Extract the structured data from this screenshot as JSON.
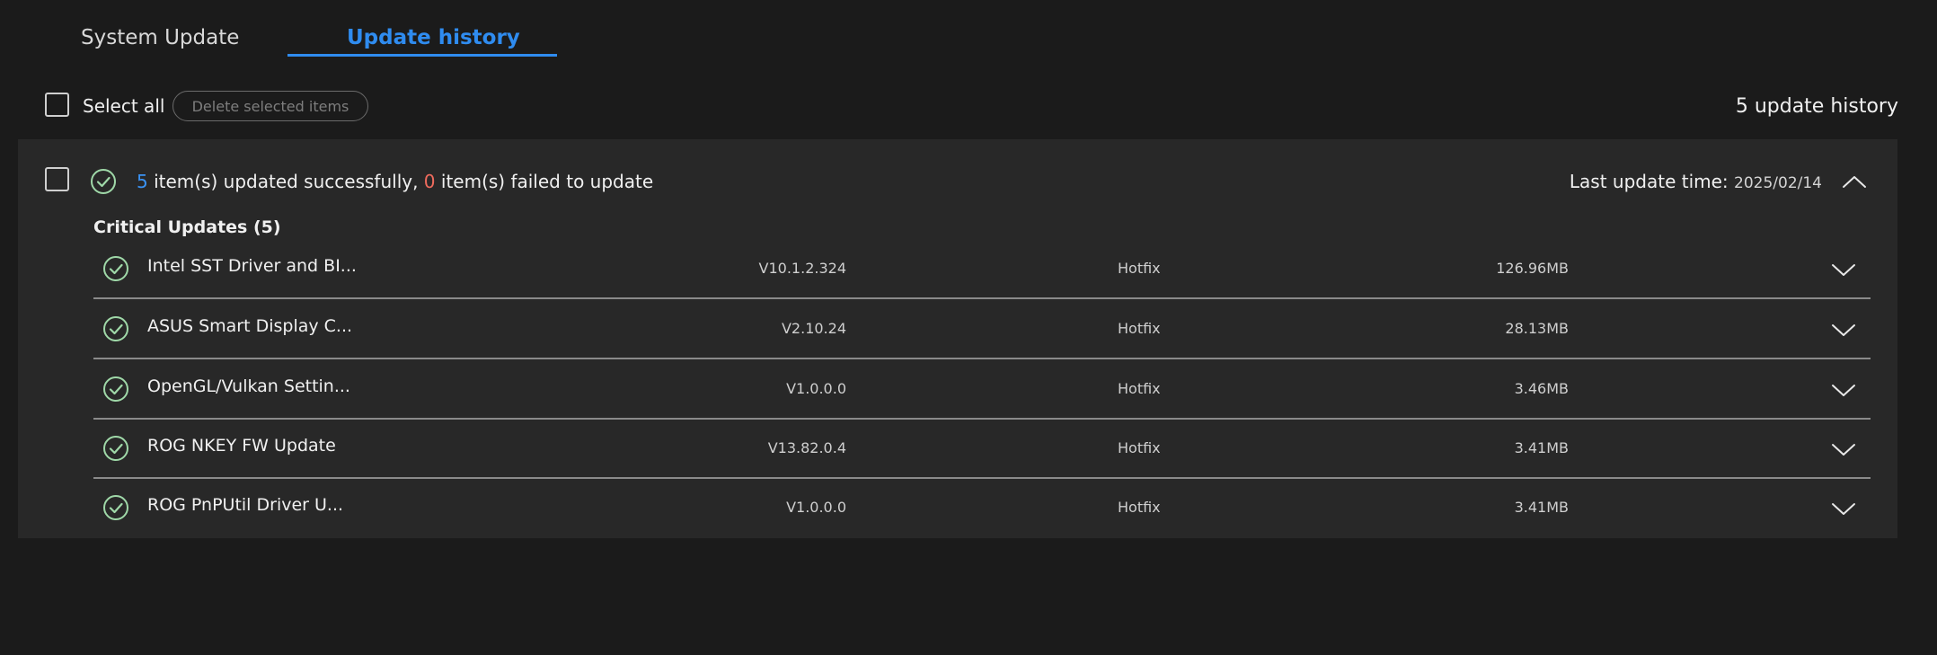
{
  "tabs": [
    {
      "label": "System Update",
      "active": false
    },
    {
      "label": "Update history",
      "active": true
    }
  ],
  "toolbar": {
    "select_all_label": "Select all",
    "delete_label": "Delete selected items",
    "history_count_label": "5 update history"
  },
  "summary": {
    "success_count": "5",
    "success_text": " item(s) updated successfully, ",
    "fail_count": "0",
    "fail_text": " item(s) failed to update",
    "last_update_label": "Last update time: ",
    "last_update_date": "2025/02/14"
  },
  "group": {
    "title": "Critical Updates (5)",
    "items": [
      {
        "name": "Intel SST Driver and BI...",
        "version": "V10.1.2.324",
        "type": "Hotfix",
        "size": "126.96MB"
      },
      {
        "name": "ASUS Smart Display C...",
        "version": "V2.10.24",
        "type": "Hotfix",
        "size": "28.13MB"
      },
      {
        "name": "OpenGL/Vulkan Settin...",
        "version": "V1.0.0.0",
        "type": "Hotfix",
        "size": "3.46MB"
      },
      {
        "name": "ROG NKEY FW Update",
        "version": "V13.82.0.4",
        "type": "Hotfix",
        "size": "3.41MB"
      },
      {
        "name": "ROG PnPUtil Driver U...",
        "version": "V1.0.0.0",
        "type": "Hotfix",
        "size": "3.41MB"
      }
    ]
  },
  "colors": {
    "accent": "#2f8cf0",
    "success_count": "#3a93f5",
    "fail_count": "#ef6b5d",
    "check_green": "#9fd8a8",
    "background": "#1b1b1b",
    "panel": "#282828"
  },
  "icons": {
    "status": "check-circle-icon",
    "expand": "chevron-down-icon",
    "collapse": "chevron-up-icon"
  }
}
